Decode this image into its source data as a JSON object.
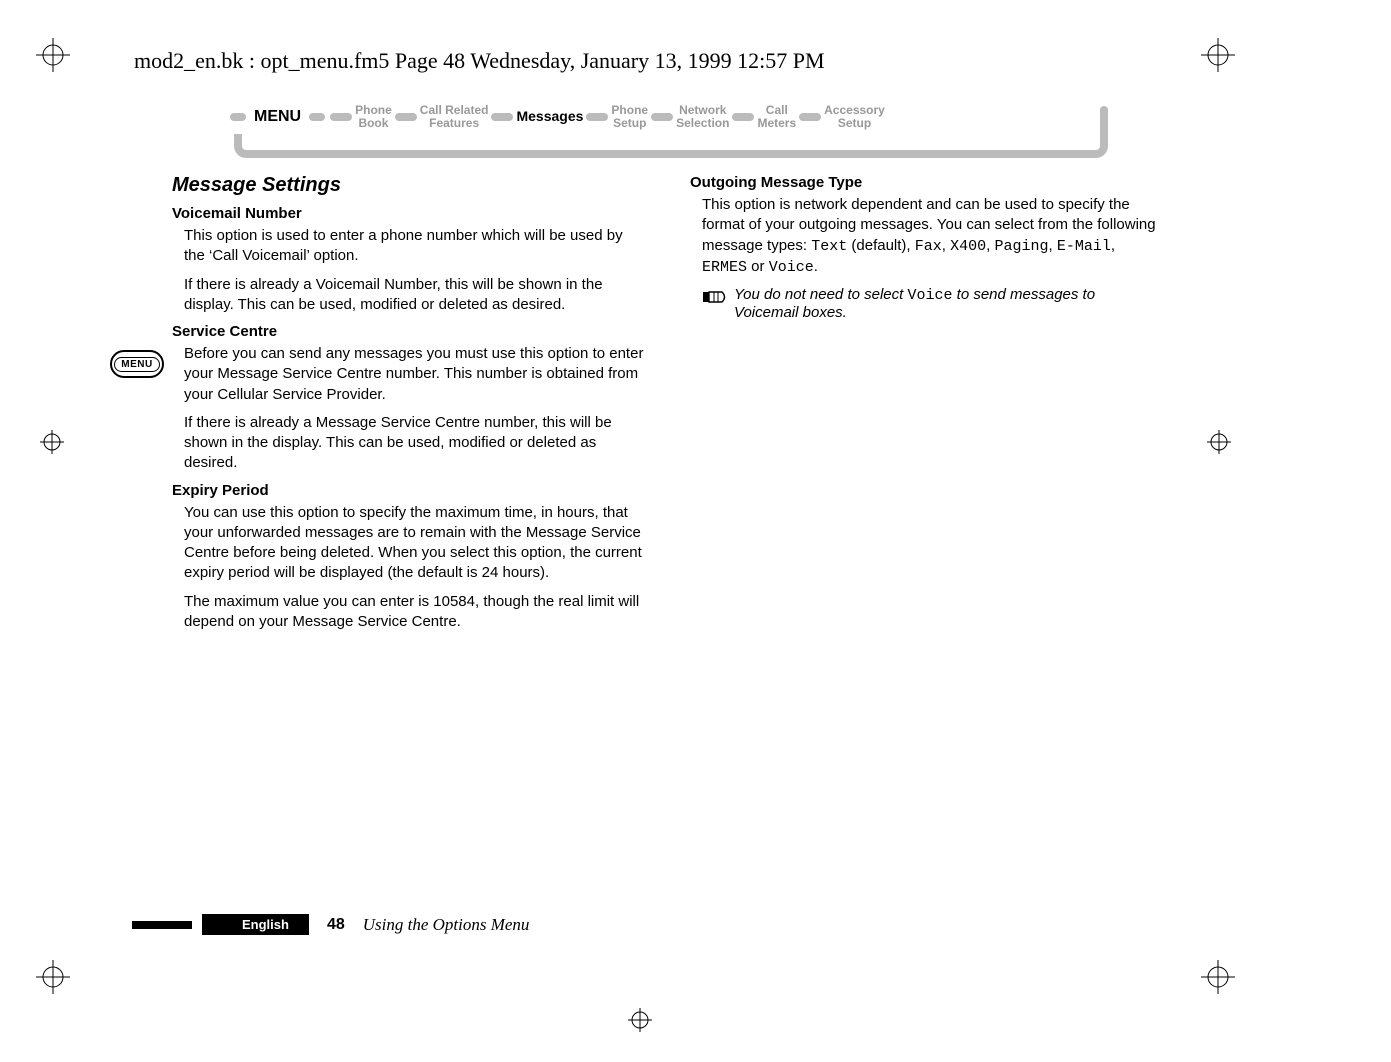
{
  "header_line": "mod2_en.bk : opt_menu.fm5  Page 48  Wednesday, January 13, 1999  12:57 PM",
  "nav": {
    "menu": "MENU",
    "items": [
      {
        "l1": "Phone",
        "l2": "Book",
        "active": false
      },
      {
        "l1": "Call Related",
        "l2": "Features",
        "active": false
      },
      {
        "l1": "Messages",
        "l2": "",
        "active": true
      },
      {
        "l1": "Phone",
        "l2": "Setup",
        "active": false
      },
      {
        "l1": "Network",
        "l2": "Selection",
        "active": false
      },
      {
        "l1": "Call",
        "l2": "Meters",
        "active": false
      },
      {
        "l1": "Accessory",
        "l2": "Setup",
        "active": false
      }
    ]
  },
  "menu_badge": "MENU",
  "left": {
    "title": "Message Settings",
    "s1_h": "Voicemail Number",
    "s1_p1": "This option is used to enter a phone number which will be used by the ‘Call Voicemail’ option.",
    "s1_p2": "If there is already a Voicemail Number, this will be shown in the display. This can be used, modified or deleted as desired.",
    "s2_h": "Service Centre",
    "s2_p1": "Before you can send any messages you must use this option to enter your Message Service Centre number. This number is obtained from your Cellular Service Provider.",
    "s2_p2": "If there is already a Message Service Centre number, this will be shown in the display. This can be used, modified or deleted as desired.",
    "s3_h": "Expiry Period",
    "s3_p1": "You can use this option to specify the maximum time, in hours, that your unforwarded messages are to remain with the Message Service Centre before being deleted. When you select this option, the current expiry period will be displayed (the default is 24 hours).",
    "s3_p2": "The maximum value you can enter is 10584, though the real limit will depend on your Message Service Centre."
  },
  "right": {
    "s1_h": "Outgoing Message Type",
    "s1_pre": "This option is network dependent and can be used to specify the format of your outgoing messages. You can select from the following message types: ",
    "mt": {
      "t1": "Text",
      "def": " (default), ",
      "t2": "Fax",
      "c1": ", ",
      "t3": "X400",
      "c2": ", ",
      "t4": "Paging",
      "c3": ", ",
      "t5": "E-Mail",
      "c4": ", ",
      "t6": "ERMES",
      "or": " or ",
      "t7": "Voice",
      "end": "."
    },
    "note_a": "You do not need to select ",
    "note_voice": "Voice",
    "note_b": " to send messages to Voicemail boxes."
  },
  "footer": {
    "lang": "English",
    "page": "48",
    "section": "Using the Options Menu"
  }
}
